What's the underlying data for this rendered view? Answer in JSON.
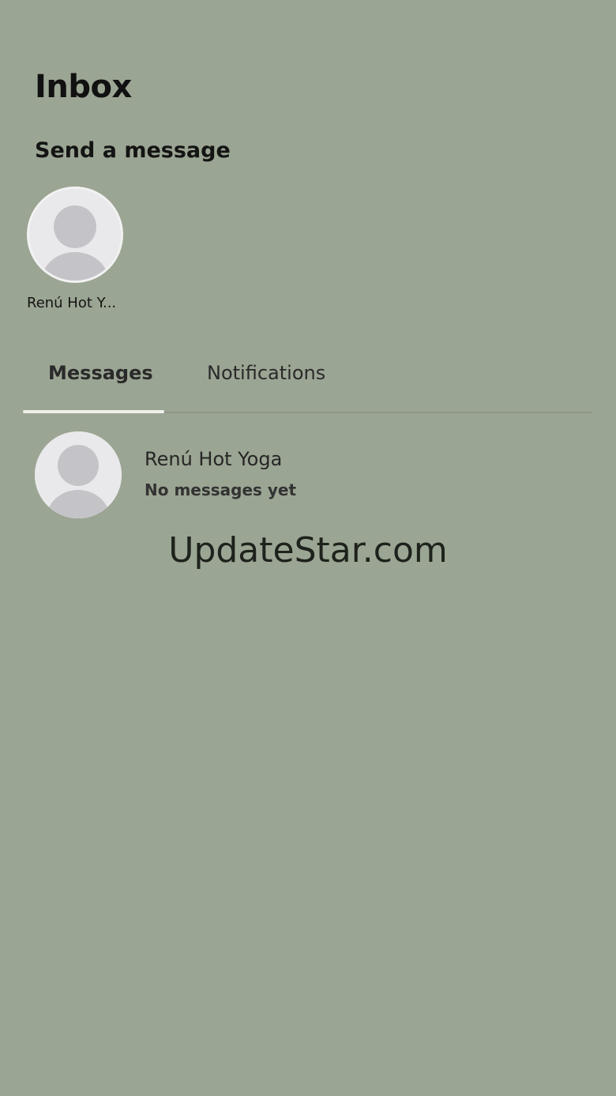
{
  "header": {
    "title": "Inbox"
  },
  "send_message": {
    "title": "Send a message",
    "contacts": [
      {
        "name": "Renú Hot Y...",
        "avatar_icon": "default-user-avatar-icon"
      }
    ]
  },
  "tabs": [
    {
      "label": "Messages",
      "active": true
    },
    {
      "label": "Notifications",
      "active": false
    }
  ],
  "conversations": [
    {
      "name": "Renú Hot Yoga",
      "preview": "No messages yet",
      "avatar_icon": "default-user-avatar-icon"
    }
  ],
  "watermark": "UpdateStar.com",
  "colors": {
    "background": "#9ba593",
    "active_tab_indicator": "#eef0ea",
    "avatar_background": "#e6e6e8",
    "avatar_silhouette": "#c3c3c7"
  }
}
